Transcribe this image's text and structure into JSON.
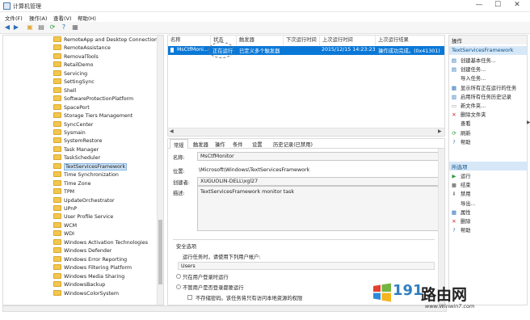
{
  "window": {
    "title": "计算机管理"
  },
  "window_controls": {
    "minimize": "—",
    "maximize": "☐",
    "close": "✕"
  },
  "menu": [
    "文件(F)",
    "操作(A)",
    "查看(V)",
    "帮助(H)"
  ],
  "tree": {
    "items": [
      "RemoteApp and Desktop Connections",
      "RemoteAssistance",
      "RemovalTools",
      "RetailDemo",
      "Servicing",
      "SettingSync",
      "Shell",
      "SoftwareProtectionPlatform",
      "SpacePort",
      "Storage Tiers Management",
      "SyncCenter",
      "Sysmain",
      "SystemRestore",
      "Task Manager",
      "TaskScheduler",
      "TextServicesFramework",
      "Time Synchronization",
      "Time Zone",
      "TPM",
      "UpdateOrchestrator",
      "UPnP",
      "User Profile Service",
      "WCM",
      "WDI",
      "Windows Activation Technologies",
      "Windows Defender",
      "Windows Error Reporting",
      "Windows Filtering Platform",
      "Windows Media Sharing",
      "WindowsBackup",
      "WindowsColorSystem"
    ],
    "selected_index": 15
  },
  "task_list": {
    "columns": [
      "名称",
      "状态",
      "触发器",
      "下次运行时间",
      "上次运行时间",
      "上次运行结果"
    ],
    "row": {
      "name": "MsCtfMoni...",
      "status": "正在运行",
      "trigger": "已定义多个触发器",
      "next_run": "",
      "last_run": "2015/12/15 14:23:23",
      "last_result": "操作成功完成。(0x41301)"
    }
  },
  "details": {
    "tabs": [
      "常规",
      "触发器",
      "操作",
      "条件",
      "设置",
      "历史记录(已禁用)"
    ],
    "active_tab": "常规",
    "name_label": "名称:",
    "name_value": "MsCtfMonitor",
    "location_label": "位置:",
    "location_value": "\\Microsoft\\Windows\\TextServicesFramework",
    "author_label": "创建者:",
    "author_value": "XUGUOLIN-DELL\\xgl27",
    "desc_label": "描述:",
    "desc_value": "TextServicesFramework monitor task",
    "security": {
      "title": "安全选项",
      "run_as_label": "运行任务时，请使用下列用户帐户:",
      "user": "Users",
      "option_logged_on": "只在用户登录时运行",
      "option_any": "不管用户是否登录都要运行",
      "option_no_password": "不存储密码。该任务将只有访问本地资源的权限"
    }
  },
  "actions": {
    "main_header": "操作",
    "main_subheader": "TextServicesFramework",
    "main_items": [
      {
        "label": "创建基本任务...",
        "icon": "task-icon",
        "color": "blue"
      },
      {
        "label": "创建任务...",
        "icon": "task-icon",
        "color": "blue"
      },
      {
        "label": "导入任务...",
        "icon": "",
        "color": ""
      },
      {
        "label": "显示所有正在运行的任务",
        "icon": "list-icon",
        "color": "blue"
      },
      {
        "label": "启用所有任务历史记录",
        "icon": "history-icon",
        "color": "blue"
      },
      {
        "label": "新文件夹...",
        "icon": "folder-icon",
        "color": "gray"
      },
      {
        "label": "删除文件夹",
        "icon": "delete-icon",
        "color": "red"
      },
      {
        "label": "查看",
        "icon": "",
        "color": "",
        "submenu": true
      },
      {
        "label": "刷新",
        "icon": "refresh-icon",
        "color": "green"
      },
      {
        "label": "帮助",
        "icon": "help-icon",
        "color": "blue"
      }
    ],
    "selected_header": "所选项",
    "selected_items": [
      {
        "label": "运行",
        "icon": "play-icon",
        "color": "green"
      },
      {
        "label": "结束",
        "icon": "stop-icon",
        "color": "gray"
      },
      {
        "label": "禁用",
        "icon": "disable-icon",
        "color": "gray"
      },
      {
        "label": "导出...",
        "icon": "",
        "color": ""
      },
      {
        "label": "属性",
        "icon": "properties-icon",
        "color": "blue"
      },
      {
        "label": "删除",
        "icon": "delete-icon",
        "color": "red"
      },
      {
        "label": "帮助",
        "icon": "help-icon",
        "color": "blue"
      }
    ]
  },
  "watermark": {
    "number": "191",
    "brand": "路由网",
    "url": "www.Winwin7.com"
  },
  "colors": {
    "selection": "#0a78d7",
    "subheader": "#d6e8f8",
    "folder": "#f2c74e"
  }
}
